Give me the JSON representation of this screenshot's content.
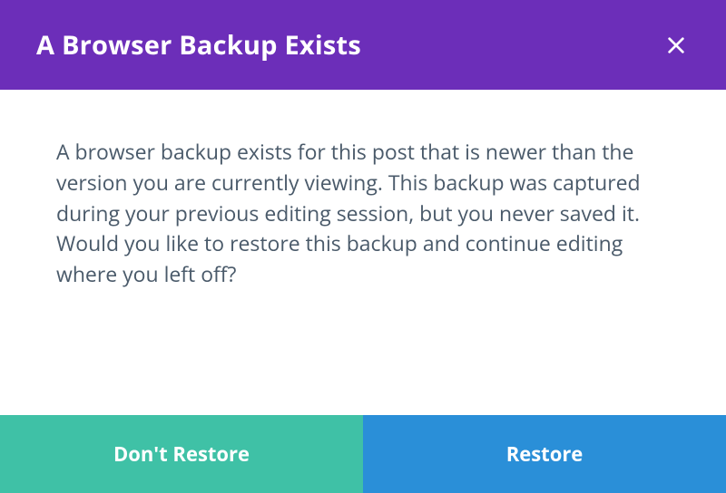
{
  "dialog": {
    "title": "A Browser Backup Exists",
    "message": "A browser backup exists for this post that is newer than the version you are currently viewing. This backup was captured during your previous editing session, but you never saved it. Would you like to restore this backup and continue editing where you left off?",
    "buttons": {
      "cancel": "Don't Restore",
      "confirm": "Restore"
    }
  },
  "colors": {
    "header_bg": "#6c2eb9",
    "cancel_bg": "#3fc1a6",
    "confirm_bg": "#2a8fd8",
    "body_text": "#4a5a6a"
  }
}
